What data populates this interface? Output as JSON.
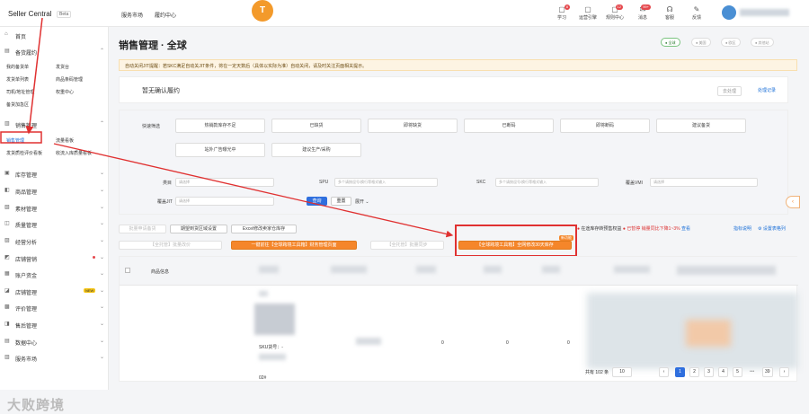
{
  "header": {
    "logo": "Seller Central",
    "beta": "Beta",
    "nav": [
      "服务市场",
      "履约中心"
    ],
    "center_badge": "T",
    "icons": [
      {
        "label": "学习",
        "badge": "8"
      },
      {
        "label": "运营引擎",
        "badge": ""
      },
      {
        "label": "规则中心",
        "badge": "12"
      },
      {
        "label": "消息",
        "badge": "99+"
      },
      {
        "label": "客服",
        "badge": ""
      },
      {
        "label": "反馈",
        "badge": ""
      }
    ]
  },
  "sidebar": {
    "items": [
      {
        "label": "首页",
        "ico": "⌂"
      },
      {
        "label": "备货履约",
        "ico": "▤"
      }
    ],
    "sub1": [
      "我的备货单",
      "发货台",
      "发货单列表",
      "商品条码管理",
      "司机/地址管理",
      "权重中心",
      "备货加急区"
    ],
    "sales": {
      "label": "销售管理",
      "ico": "▥"
    },
    "sub2": [
      "销售管理",
      "流量看板",
      "发货质检评价看板",
      "收流入库质量看板"
    ],
    "more": [
      {
        "label": "库存管理",
        "ico": "▣"
      },
      {
        "label": "商品管理",
        "ico": "◧"
      },
      {
        "label": "素材管理",
        "ico": "▧"
      },
      {
        "label": "质量管理",
        "ico": "◫"
      },
      {
        "label": "经营分析",
        "ico": "▨"
      },
      {
        "label": "店铺营销",
        "ico": "◩"
      },
      {
        "label": "账户资金",
        "ico": "▦"
      },
      {
        "label": "店铺管理",
        "ico": "◪",
        "new": "NEW"
      },
      {
        "label": "评价管理",
        "ico": "▩"
      },
      {
        "label": "售后管理",
        "ico": "◨"
      },
      {
        "label": "数据中心",
        "ico": "▤"
      },
      {
        "label": "服务市场",
        "ico": "▥"
      }
    ],
    "watermark": "大败跨境"
  },
  "main": {
    "title": "销售管理 · 全球",
    "scopes": [
      "● 全球",
      "● 美国",
      "● 欧区",
      "● 其他站"
    ],
    "notice": "自动关闭JIT提醒：若SKC满足自动关JIT条件，将在一定天数后（具体以实际为准）自动关闭，请及时关注页面相关提示。",
    "pending": "暂无确认履约",
    "pending_btn": "去处理",
    "pending_link": "处理记录",
    "quick_label": "快速筛选",
    "chips": [
      "热销款库存不足",
      "已缺货",
      "即将缺货",
      "已断码",
      "即将断码",
      "建议备货",
      "站外广告曝光中",
      "建议生产/采购"
    ],
    "filters": [
      {
        "label": "类目",
        "ph": "请选择"
      },
      {
        "label": "SPU",
        "ph": "多个请按逗号/换行等格式输入"
      },
      {
        "label": "SKC",
        "ph": "多个请按逗号/换行等格式输入"
      },
      {
        "label": "覆盖VMI",
        "ph": "请选择"
      },
      {
        "label": "覆盖JIT",
        "ph": "请选择"
      }
    ],
    "query": "查询",
    "reset": "重置",
    "expand": "展开 ⌄",
    "tools": [
      "批量申请备货",
      "期望到货区域设置",
      "Excel修改卖家仓库存",
      "【全托管】批量改价",
      "一键前往【全球跨境工具箱】财务管理页面",
      "【全托管】批量同步",
      "【全球跨境工具箱】全网修改30天库存"
    ],
    "tool_tag": "新功能",
    "warn_a": "在途库存转预售权益",
    "warn_b": "已暂停",
    "warn_c": "销量同比下降1~3%",
    "warn_link": "查看",
    "right_links": [
      "指标说明",
      "⚙ 设置表格列"
    ],
    "table_head": "商品信息",
    "row_text": "SKU货号：-",
    "row2": "02#",
    "zeros": [
      "0",
      "0",
      "0"
    ],
    "pager": {
      "total": "共有 102 条",
      "size": "10",
      "prev": "‹",
      "pages": [
        "1",
        "2",
        "3",
        "4",
        "5"
      ],
      "dots": "•••",
      "last": "39",
      "next": "›"
    }
  }
}
